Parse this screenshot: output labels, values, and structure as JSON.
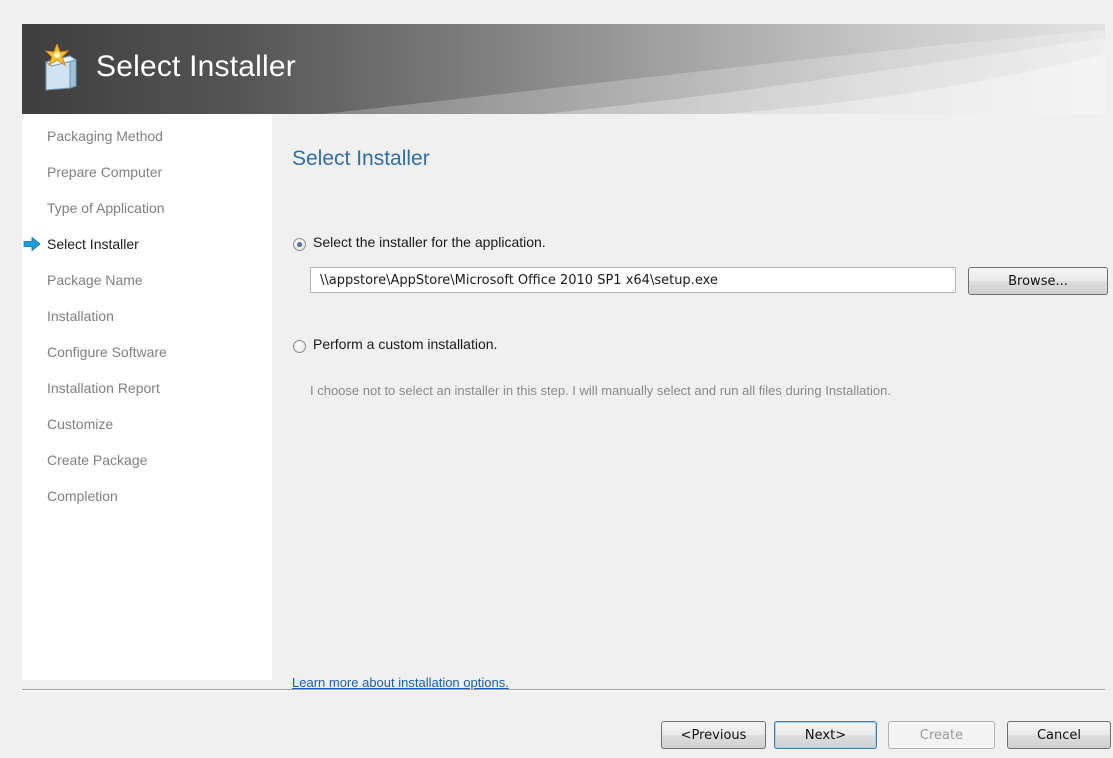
{
  "window": {
    "title": "Select Installer",
    "app_icon": "package-sparkle-icon"
  },
  "sidebar": {
    "current_marker_icon": "arrow-right-icon",
    "items": [
      {
        "label": "Packaging Method"
      },
      {
        "label": "Prepare Computer"
      },
      {
        "label": "Type of Application"
      },
      {
        "label": "Select Installer",
        "current": true
      },
      {
        "label": "Package Name"
      },
      {
        "label": "Installation"
      },
      {
        "label": "Configure Software"
      },
      {
        "label": "Installation Report"
      },
      {
        "label": "Customize"
      },
      {
        "label": "Create Package"
      },
      {
        "label": "Completion"
      }
    ]
  },
  "main": {
    "heading": "Select Installer",
    "option_installer": {
      "label": "Select the installer for the application.",
      "selected": true,
      "path_value": "\\\\appstore\\AppStore\\Microsoft Office 2010 SP1 x64\\setup.exe",
      "browse_label": "Browse..."
    },
    "option_custom": {
      "label": "Perform a custom installation.",
      "selected": false,
      "description": "I choose not to select an installer in this step.  I will manually select and run all files during Installation."
    },
    "learn_more_link": "Learn more about installation options."
  },
  "footer": {
    "previous_label": "<Previous",
    "next_label": "Next>",
    "create_label": "Create",
    "create_enabled": false,
    "cancel_label": "Cancel"
  },
  "colors": {
    "heading_blue": "#2e6fa8",
    "link_blue": "#1a5fb4",
    "banner_dark": "#3e3e3e",
    "banner_light": "#e3e3e3",
    "sidebar_bg": "#ffffff",
    "content_bg": "#f0f0f0",
    "nav_arrow": "#1c9cd8"
  }
}
